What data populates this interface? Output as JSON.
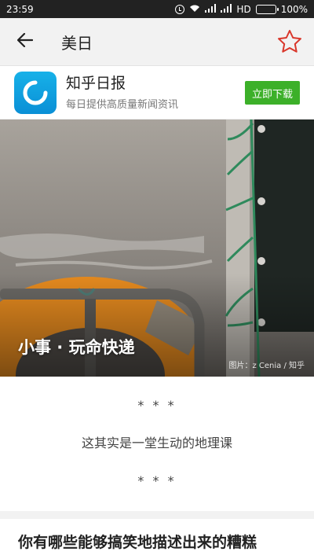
{
  "status_bar": {
    "time": "23:59",
    "network": "HD",
    "battery": "100%",
    "icons": [
      "alarm-icon",
      "wifi-icon",
      "signal-icon",
      "signal-icon",
      "battery-icon"
    ],
    "battery_level": 1.0
  },
  "app_bar": {
    "title": "美日",
    "back_icon": "arrow-left-icon",
    "favorite_icon": "star-outline-icon",
    "accent_color": "#d9372b"
  },
  "ad": {
    "app_name": "知乎日报",
    "tagline": "每日提供高质量新闻资讯",
    "button_label": "立即下载",
    "button_color": "#3cb029",
    "logo_color": "#12a4e3"
  },
  "hero": {
    "title": "小事 · 玩命快递",
    "credit": "图片：z Cenia / 知乎"
  },
  "article": {
    "separator_top": "* * *",
    "lead": "这其实是一堂生动的地理课",
    "separator_bottom": "* * *"
  },
  "next_section": {
    "title": "你有哪些能够搞笑地描述出来的糟糕"
  }
}
